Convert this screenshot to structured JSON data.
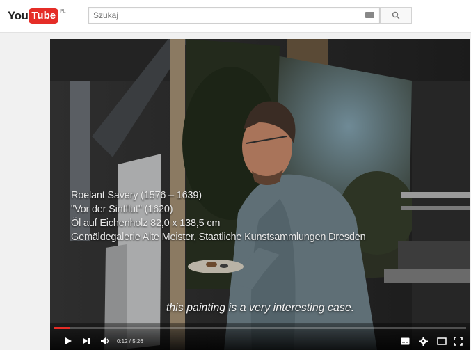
{
  "header": {
    "logo_you": "You",
    "logo_tube": "Tube",
    "logo_region": "PL",
    "search_placeholder": "Szukaj"
  },
  "player": {
    "caption_lines": [
      "Roelant Savery (1576 – 1639)",
      "\"Vor der Sintflut\" (1620)",
      "Öl auf Eichenholz 82,0 x 138,5 cm",
      "Gemäldegalerie Alte Meister, Staatliche Kunstsammlungen Dresden"
    ],
    "subtitle": "this painting is a very interesting case.",
    "time_display": "0:12 / 5:26",
    "progress_fraction": 0.037
  },
  "colors": {
    "brand_red": "#e52d27",
    "player_bg": "#151515"
  }
}
